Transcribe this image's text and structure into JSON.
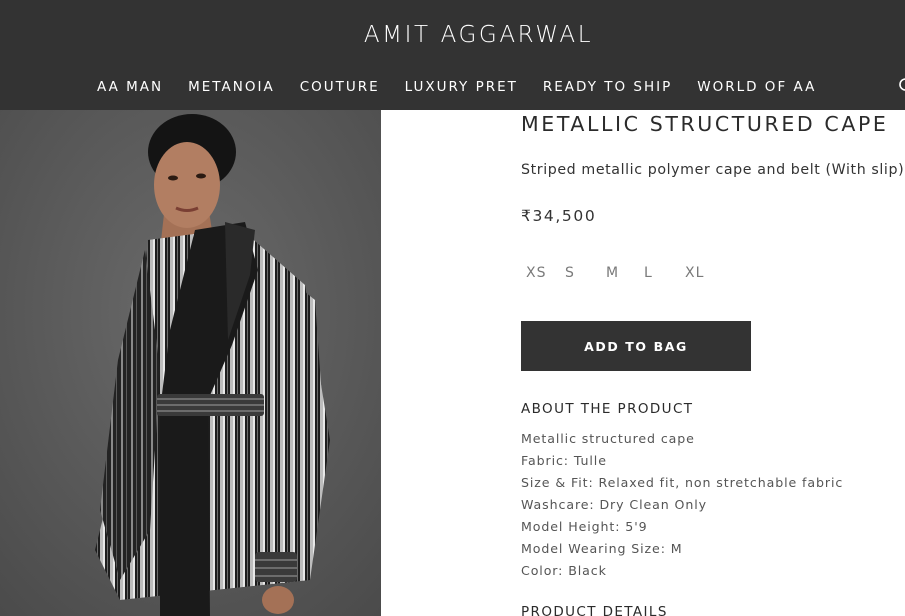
{
  "header": {
    "logo": "AMIT AGGARWAL",
    "nav": [
      "AA MAN",
      "METANOIA",
      "COUTURE",
      "LUXURY PRET",
      "READY TO SHIP",
      "WORLD OF AA"
    ]
  },
  "product": {
    "title": "METALLIC STRUCTURED CAPE",
    "description": "Striped metallic polymer cape and belt (With slip)",
    "price": "₹34,500",
    "sizes": [
      "XS",
      "S",
      "M",
      "L",
      "XL"
    ],
    "add_to_bag": "ADD TO BAG",
    "about_title": "ABOUT THE PRODUCT",
    "details": [
      "Metallic structured cape",
      "Fabric: Tulle",
      "Size & Fit: Relaxed fit, non stretchable fabric",
      "Washcare: Dry Clean Only",
      "Model Height: 5'9",
      "Model Wearing Size: M",
      "Color: Black"
    ],
    "product_details_title": "PRODUCT DETAILS"
  },
  "colors": {
    "header_bg": "#333333",
    "button_bg": "#333333",
    "photo_bg": "#5a5a5a"
  },
  "icons": {
    "search": "search-icon"
  }
}
